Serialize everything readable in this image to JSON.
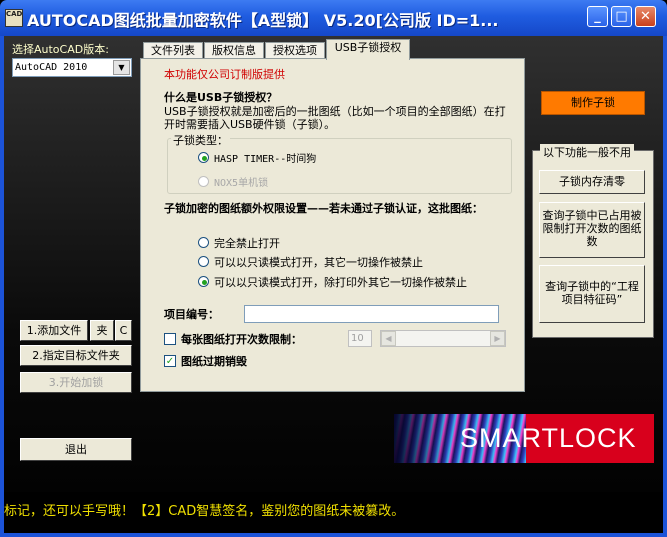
{
  "window": {
    "title": "AUTOCAD图纸批量加密软件【A型锁】 V5.20[公司版 ID=1...",
    "icon_text": "CAD",
    "minimize": "_",
    "maximize": "□",
    "close": "✕"
  },
  "left": {
    "version_label": "选择AutoCAD版本:",
    "version_value": "AutoCAD 2010",
    "dropdown_arrow": "▼",
    "add_file": "1.添加文件",
    "add_folder": "夹",
    "clear": "C",
    "target_folder": "2.指定目标文件夹",
    "start": "3.开始加锁",
    "exit": "退出"
  },
  "tabs": [
    {
      "label": "文件列表"
    },
    {
      "label": "版权信息"
    },
    {
      "label": "授权选项"
    },
    {
      "label": "USB子锁授权"
    }
  ],
  "usb": {
    "note": "本功能仅公司订制版提供",
    "q_title": "什么是USB子锁授权？",
    "desc": "USB子锁授权就是加密后的一批图纸（比如一个项目的全部图纸）在打开时需要插入USB硬件锁（子锁）。",
    "type_label": "子锁类型：",
    "type_options": [
      {
        "label": "HASP TIMER--时间狗",
        "selected": true,
        "enabled": true
      },
      {
        "label": "NOX5单机锁",
        "selected": false,
        "enabled": false
      }
    ],
    "perm_title": "子锁加密的图纸额外权限设置——若未通过子锁认证，这批图纸：",
    "perm_options": [
      {
        "label": "完全禁止打开",
        "selected": false
      },
      {
        "label": "可以以只读模式打开，其它一切操作被禁止",
        "selected": false
      },
      {
        "label": "可以以只读模式打开，除打印外其它一切操作被禁止",
        "selected": true
      }
    ],
    "project_label": "项目编号：",
    "project_value": "",
    "limit_label": "每张图纸打开次数限制：",
    "limit_checked": false,
    "limit_value": "10",
    "slider_left": "◀",
    "slider_right": "▶",
    "expire_label": "图纸过期销毁",
    "expire_checked": true,
    "check_mark": "✓"
  },
  "right": {
    "make_button": "制作子锁",
    "group_label": "以下功能一般不用",
    "clear_mem": "子锁内存清零",
    "query_count": "查询子锁中已占用被限制打开次数的图纸数",
    "query_code": "查询子锁中的“工程项目特征码”"
  },
  "logo": {
    "text": "SMARTLOCK"
  },
  "marquee": {
    "text": "标记，还可以手写哦！【2】CAD智慧签名，鉴别您的图纸未被篡改。"
  },
  "colors": {
    "titlebar": "#1f5ce0",
    "accent_orange": "#ff7a00",
    "note_red": "#d00000",
    "marquee_yellow": "#f0e000",
    "logo_red": "#d8001c"
  }
}
